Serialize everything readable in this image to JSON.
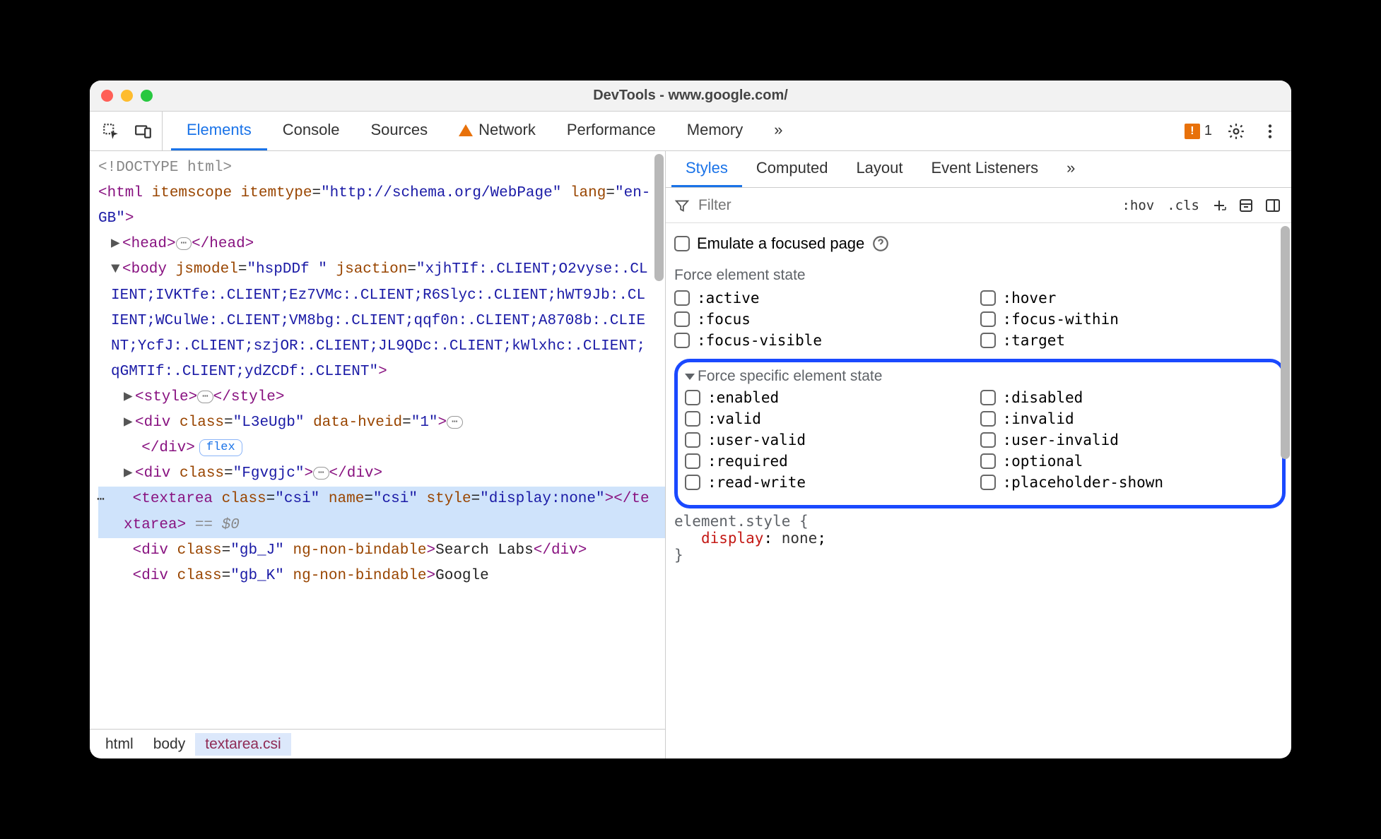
{
  "window": {
    "title": "DevTools - www.google.com/"
  },
  "toolbar": {
    "tabs": [
      "Elements",
      "Console",
      "Sources",
      "Network",
      "Performance",
      "Memory"
    ],
    "active_tab": "Elements",
    "more": "»",
    "issues_count": "1"
  },
  "dom": {
    "doctype": "<!DOCTYPE html>",
    "html_open": {
      "tag": "html",
      "attrs": "itemscope itemtype=\"http://schema.org/WebPage\" lang=\"en-GB\""
    },
    "head": {
      "tag": "head"
    },
    "body_open": {
      "tag": "body",
      "attrs": "jsmodel=\"hspDDf \" jsaction=\"xjhTIf:.CLIENT;O2vyse:.CLIENT;IVKTfe:.CLIENT;Ez7VMc:.CLIENT;R6Slyc:.CLIENT;hWT9Jb:.CLIENT;WCulWe:.CLIENT;VM8bg:.CLIENT;qqf0n:.CLIENT;A8708b:.CLIENT;YcfJ:.CLIENT;szjOR:.CLIENT;JL9QDc:.CLIENT;kWlxhc:.CLIENT;qGMTIf:.CLIENT;ydZCDf:.CLIENT\""
    },
    "style_row": {
      "tag": "style"
    },
    "div1": {
      "tag": "div",
      "attrs": "class=\"L3eUgb\" data-hveid=\"1\"",
      "close": "</div>",
      "flex_badge": "flex"
    },
    "div2": {
      "tag": "div",
      "attrs": "class=\"Fgvgjc\""
    },
    "textarea_row": {
      "open": "<textarea class=\"csi\" name=\"csi\" style=\"display:none\"></textarea>",
      "eq": " == $0"
    },
    "div3_text": "<div class=\"gb_J\" ng-non-bindable>Search Labs</div>",
    "div4_text": "<div class=\"gb_K\" ng-non-bindable>Google"
  },
  "breadcrumb": [
    "html",
    "body",
    "textarea.csi"
  ],
  "styles": {
    "subtabs": [
      "Styles",
      "Computed",
      "Layout",
      "Event Listeners"
    ],
    "active_subtab": "Styles",
    "subtabs_more": "»",
    "filter_placeholder": "Filter",
    "hov": ":hov",
    "cls": ".cls",
    "emulate_label": "Emulate a focused page",
    "force_label": "Force element state",
    "states1": [
      ":active",
      ":hover",
      ":focus",
      ":focus-within",
      ":focus-visible",
      ":target"
    ],
    "force_specific_label": "Force specific element state",
    "states2": [
      ":enabled",
      ":disabled",
      ":valid",
      ":invalid",
      ":user-valid",
      ":user-invalid",
      ":required",
      ":optional",
      ":read-write",
      ":placeholder-shown"
    ],
    "css": {
      "selector": "element.style {",
      "prop": "display",
      "val": "none",
      "close": "}"
    }
  }
}
